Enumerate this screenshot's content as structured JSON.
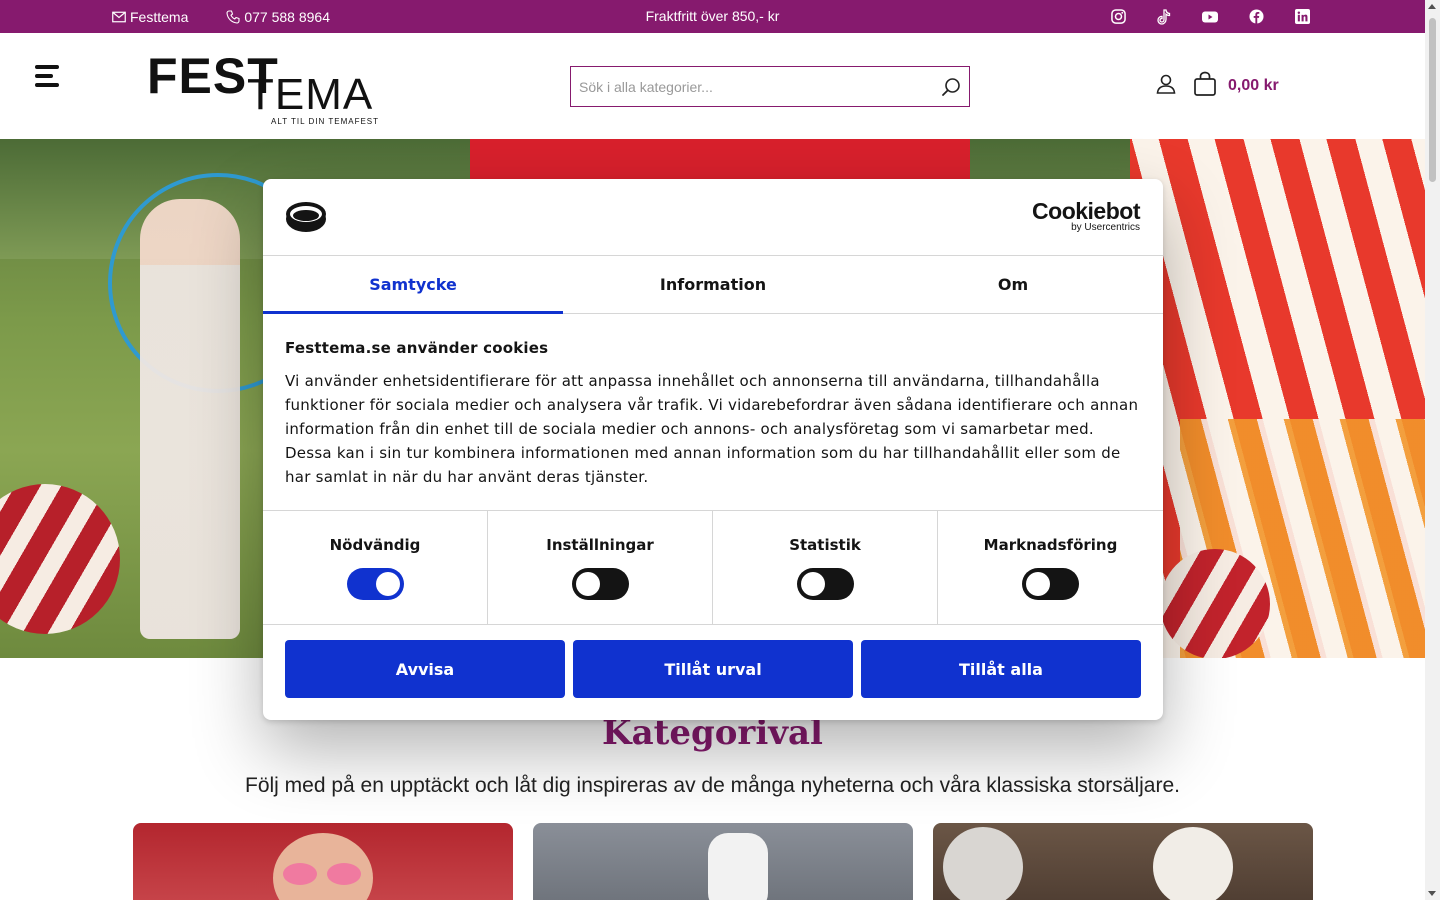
{
  "topbar": {
    "email_label": "Festtema",
    "phone_label": "077 588 8964",
    "promo_text": "Fraktfritt över 850,- kr",
    "social_icons": [
      "instagram-icon",
      "tiktok-icon",
      "youtube-icon",
      "facebook-icon",
      "linkedin-icon"
    ],
    "background_color": "#861a6e"
  },
  "header": {
    "logo": {
      "line1": "FEST",
      "line2": "TEMA",
      "tagline": "ALT TIL DIN TEMAFEST"
    },
    "search": {
      "placeholder": "Sök i alla kategorier...",
      "value": ""
    },
    "cart_total": "0,00 kr",
    "accent_color": "#861a6e"
  },
  "section": {
    "title": "Kategorival",
    "subtitle": "Följ med på en upptäckt och låt dig inspireras av de många nyheterna och våra klassiska storsäljare."
  },
  "cookie_dialog": {
    "brand": {
      "name": "Cookiebot",
      "by": "by Usercentrics"
    },
    "tabs": [
      {
        "label": "Samtycke",
        "active": true
      },
      {
        "label": "Information",
        "active": false
      },
      {
        "label": "Om",
        "active": false
      }
    ],
    "heading": "Festtema.se använder cookies",
    "body": "Vi använder enhetsidentifierare för att anpassa innehållet och annonserna till användarna, tillhandahålla funktioner för sociala medier och analysera vår trafik. Vi vidarebefordrar även sådana identifierare och annan information från din enhet till de sociala medier och annons- och analysföretag som vi samarbetar med. Dessa kan i sin tur kombinera informationen med annan information som du har tillhandahållit eller som de har samlat in när du har använt deras tjänster.",
    "toggles": [
      {
        "label": "Nödvändig",
        "on": true
      },
      {
        "label": "Inställningar",
        "on": false
      },
      {
        "label": "Statistik",
        "on": false
      },
      {
        "label": "Marknadsföring",
        "on": false
      }
    ],
    "buttons": {
      "reject": "Avvisa",
      "allow_selection": "Tillåt urval",
      "allow_all": "Tillåt alla"
    },
    "primary_color": "#1032cf"
  }
}
